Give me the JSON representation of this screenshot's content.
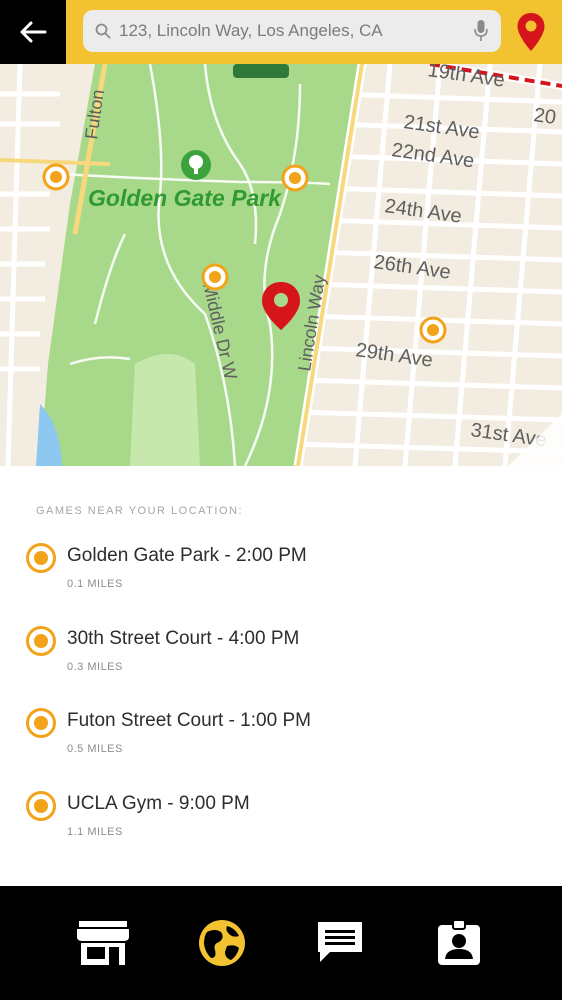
{
  "header": {
    "back_icon": "back-arrow-icon",
    "search_value": "123, Lincoln Way, Los Angeles, CA",
    "search_icon": "search-icon",
    "mic_icon": "microphone-icon",
    "location_icon": "location-pin-icon",
    "accent": "#f2c230"
  },
  "map": {
    "park_name": "Golden Gate Park",
    "streets": {
      "fulton": "Fulton",
      "lincoln": "Lincoln Way",
      "middle_dr": "Middle Dr W",
      "ave_19": "19th Ave",
      "ave_20": "20",
      "ave_21": "21st Ave",
      "ave_22": "22nd Ave",
      "ave_24": "24th Ave",
      "ave_26": "26th Ave",
      "ave_29": "29th Ave",
      "ave_31": "31st Ave"
    },
    "pin_color": "#d5141b",
    "marker_color": "#f2a31a"
  },
  "list": {
    "heading": "GAMES NEAR YOUR LOCATION:",
    "games": [
      {
        "title": "Golden Gate Park - 2:00 PM",
        "distance": "0.1 MILES"
      },
      {
        "title": "30th Street Court - 4:00 PM",
        "distance": "0.3 MILES"
      },
      {
        "title": "Futon Street Court - 1:00 PM",
        "distance": "0.5 MILES"
      },
      {
        "title": "UCLA Gym - 9:00 PM",
        "distance": "1.1 MILES"
      }
    ]
  },
  "nav": {
    "items": [
      {
        "icon": "store-icon"
      },
      {
        "icon": "globe-icon",
        "active": true
      },
      {
        "icon": "chat-icon"
      },
      {
        "icon": "profile-badge-icon"
      }
    ],
    "active_color": "#f2c230"
  }
}
